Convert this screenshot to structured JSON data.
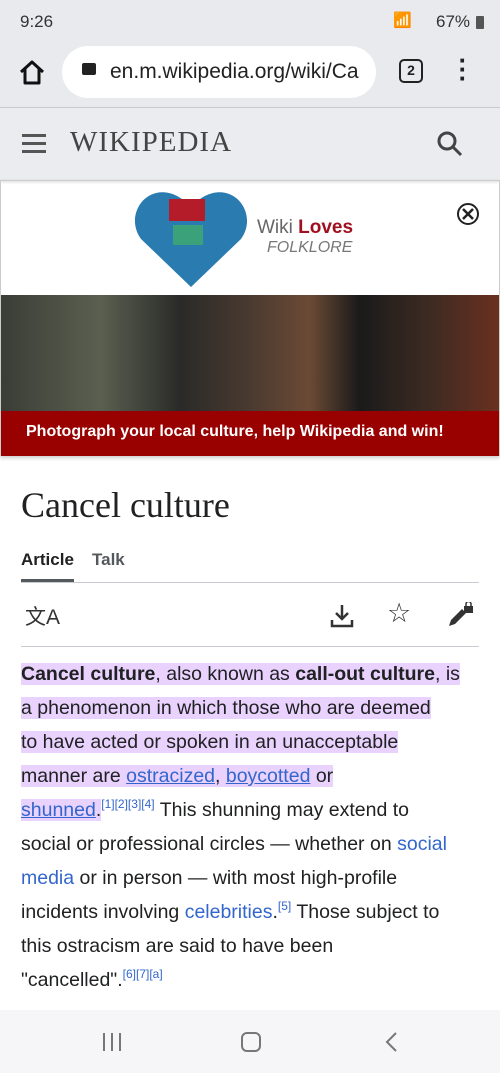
{
  "status": {
    "time": "9:26",
    "battery": "67%"
  },
  "browser": {
    "url": "en.m.wikipedia.org/wiki/Ca",
    "tab_count": "2"
  },
  "wiki": {
    "logo": "WIKIPEDIA"
  },
  "banner": {
    "logo_line1_a": "Wiki ",
    "logo_line1_b": "Loves",
    "logo_line2": "FOLKLORE",
    "cta": "Photograph your local culture, help Wikipedia and win!"
  },
  "article": {
    "title": "Cancel culture",
    "tabs": [
      "Article",
      "Talk"
    ],
    "lines": [
      [
        "Cancel culture",
        ", also known as ",
        "call-out culture",
        ", is"
      ],
      [
        "a phenomenon in which those who are deemed"
      ],
      [
        "to have acted or spoken in an unacceptable"
      ],
      [
        "manner are ",
        "ostracized",
        ", ",
        "boycotted",
        " or"
      ],
      [
        "shunned",
        ".",
        "[1][2][3][4]",
        " This shunning may extend to"
      ],
      [
        "social or professional circles — whether on ",
        "social"
      ],
      [
        "media",
        " or in person — with most high-profile"
      ],
      [
        "incidents involving ",
        "celebrities",
        ".",
        "[5]",
        " Those subject to"
      ],
      [
        "this ostracism are said to have been"
      ],
      [
        "\"cancelled\".",
        "[6][7][a]"
      ]
    ]
  },
  "colors": {
    "highlight": "#e9d2fd",
    "link": "#3366cc",
    "banner_red": "#990000"
  }
}
